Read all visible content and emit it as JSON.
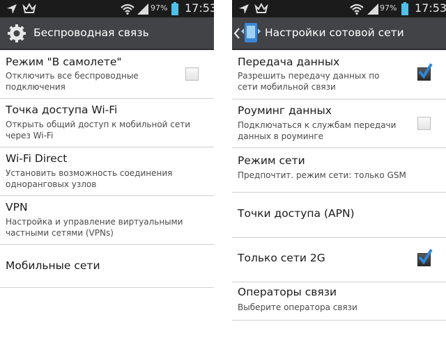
{
  "status_bar": {
    "battery_percent": "97%",
    "time": "17:53"
  },
  "left_screen": {
    "title": "Беспроводная связь",
    "title_icon": "gear-icon",
    "items": [
      {
        "title": "Режим \"В самолете\"",
        "summary": "Отключить все беспроводные подключения",
        "checkbox": true,
        "checked": false
      },
      {
        "title": "Точка доступа Wi-Fi",
        "summary": "Открыть общий доступ к мобильной сети через Wi-Fi"
      },
      {
        "title": "Wi-Fi Direct",
        "summary": "Установить возможность соединения одноранговых узлов"
      },
      {
        "title": "VPN",
        "summary": "Настройка и управление виртуальными частными сетями (VPNs)"
      },
      {
        "title": "Мобильные сети"
      }
    ]
  },
  "right_screen": {
    "title": "Настройки сотовой сети",
    "title_icon": "mobile-network-icon",
    "items": [
      {
        "title": "Передача данных",
        "summary": "Разрешить передачу данных по сети мобильной связи",
        "checkbox": true,
        "checked": true
      },
      {
        "title": "Роуминг данных",
        "summary": "Подключаться к службам передачи данных в роуминге",
        "checkbox": true,
        "checked": false
      },
      {
        "title": "Режим сети",
        "summary": "Предпочтит. режим сети: только GSM"
      },
      {
        "title": "Точки доступа (APN)"
      },
      {
        "title": "Только сети 2G",
        "checkbox": true,
        "checked": true
      },
      {
        "title": "Операторы связи",
        "summary": "Выберите оператора связи"
      }
    ]
  },
  "colors": {
    "status_bar": "#1b1b1b",
    "action_bar": "#424347",
    "battery": "#4cc2ea",
    "checkmark": "#2f86d9"
  }
}
